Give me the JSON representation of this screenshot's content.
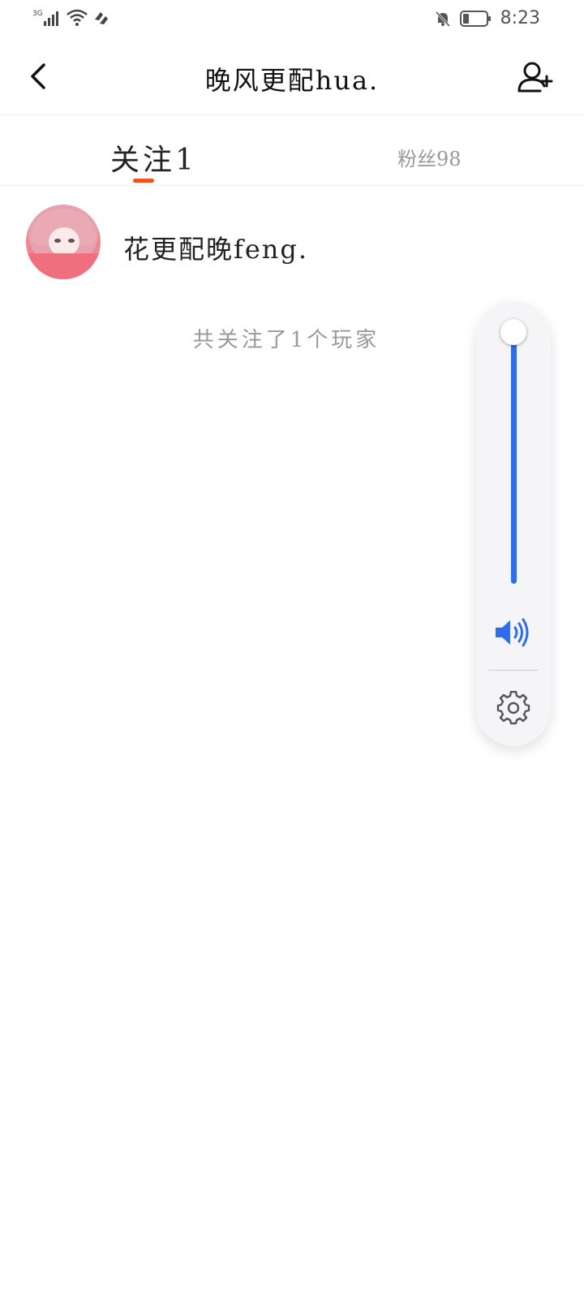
{
  "status_bar": {
    "network": "3G",
    "time": "8:23",
    "icons": [
      "signal-icon",
      "wifi-icon",
      "data-saver-icon",
      "silent-bell-icon",
      "battery-icon"
    ]
  },
  "header": {
    "title": "晚风更配hua.",
    "back_icon": "chevron-left-icon",
    "add_user_icon": "add-user-icon"
  },
  "tabs": {
    "following": "关注1",
    "fans": "粉丝98",
    "active": "following",
    "accent_color": "#f4511e"
  },
  "following_list": [
    {
      "name": "花更配晚feng."
    }
  ],
  "summary": "共关注了1个玩家",
  "volume_panel": {
    "level": 1.0,
    "accent_color": "#2f6bea",
    "speaker_icon": "speaker-icon",
    "settings_icon": "gear-icon"
  }
}
